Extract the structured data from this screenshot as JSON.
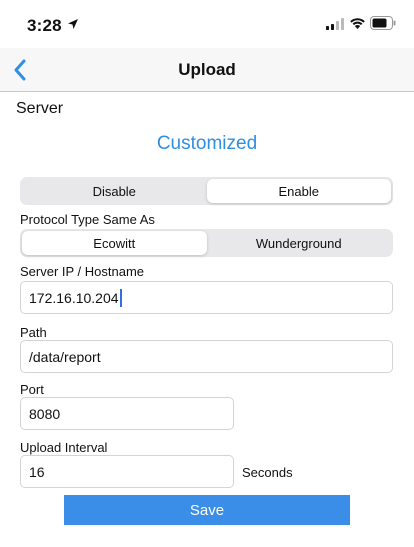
{
  "status_bar": {
    "time": "3:28"
  },
  "nav": {
    "title": "Upload"
  },
  "section": {
    "label": "Server",
    "mode_title": "Customized"
  },
  "enable_toggle": {
    "options": [
      "Disable",
      "Enable"
    ],
    "selected": "Enable"
  },
  "protocol": {
    "label": "Protocol Type Same As",
    "options": [
      "Ecowitt",
      "Wunderground"
    ],
    "selected": "Ecowitt"
  },
  "server_ip": {
    "label": "Server IP / Hostname",
    "value": "172.16.10.204"
  },
  "path": {
    "label": "Path",
    "value": "/data/report"
  },
  "port": {
    "label": "Port",
    "value": "8080"
  },
  "interval": {
    "label": "Upload Interval",
    "value": "16",
    "unit": "Seconds"
  },
  "save_label": "Save",
  "colors": {
    "accent": "#2f8fe2",
    "button": "#3b8ee8"
  }
}
